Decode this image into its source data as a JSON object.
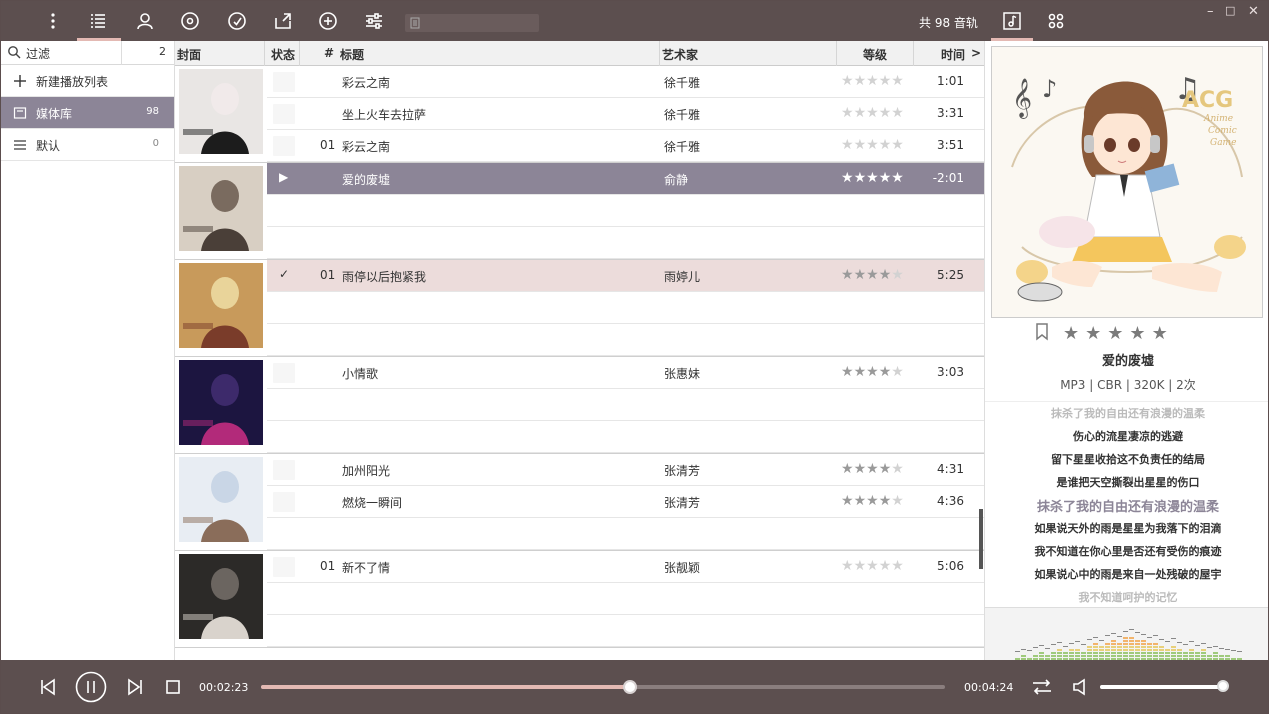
{
  "topbar": {
    "icons": [
      "more-vertical-icon",
      "list-icon",
      "user-icon",
      "disc-icon",
      "gauge-icon",
      "export-icon",
      "add-circle-icon",
      "equalizer-icon"
    ],
    "active_icon": "list-icon",
    "track_count": "共 98 音轨",
    "right_icons": [
      "music-note-icon",
      "grid-icon"
    ],
    "window_buttons": [
      "–",
      "□",
      "✕"
    ]
  },
  "sidebar": {
    "filter_label": "过滤",
    "filter_count": "2",
    "items": [
      {
        "icon": "plus-icon",
        "label": "新建播放列表",
        "count": ""
      },
      {
        "icon": "library-icon",
        "label": "媒体库",
        "count": "98",
        "active": true
      },
      {
        "icon": "list-icon",
        "label": "默认",
        "count": "0"
      }
    ]
  },
  "table": {
    "headers": {
      "cover": "封面",
      "status": "状态",
      "number": "#",
      "title": "标题",
      "artist": "艺术家",
      "rating": "等级",
      "time": "时间",
      "more": ">"
    },
    "groups": [
      {
        "cover": "cover-woman-dark",
        "rows": [
          {
            "num": "",
            "title": "彩云之南",
            "artist": "徐千雅",
            "rating": 0,
            "time": "1:01",
            "state": ""
          },
          {
            "num": "",
            "title": "坐上火车去拉萨",
            "artist": "徐千雅",
            "rating": 0,
            "time": "3:31",
            "state": ""
          },
          {
            "num": "01",
            "title": "彩云之南",
            "artist": "徐千雅",
            "rating": 0,
            "time": "3:51",
            "state": ""
          }
        ]
      },
      {
        "cover": "cover-calligraphy",
        "rows": [
          {
            "num": "",
            "title": "爱的废墟",
            "artist": "俞静",
            "rating": 5,
            "time": "-2:01",
            "state": "playing"
          },
          {
            "num": "",
            "title": "",
            "artist": "",
            "rating": -1,
            "time": "",
            "state": "empty"
          },
          {
            "num": "",
            "title": "",
            "artist": "",
            "rating": -1,
            "time": "",
            "state": "empty"
          }
        ]
      },
      {
        "cover": "cover-costume-drama",
        "rows": [
          {
            "num": "01",
            "title": "雨停以后抱紧我",
            "artist": "雨婷儿",
            "rating": 4,
            "time": "5:25",
            "state": "selected"
          },
          {
            "num": "",
            "title": "",
            "artist": "",
            "rating": -1,
            "time": "",
            "state": "empty"
          },
          {
            "num": "",
            "title": "",
            "artist": "",
            "rating": -1,
            "time": "",
            "state": "empty"
          }
        ]
      },
      {
        "cover": "cover-stage-singer",
        "rows": [
          {
            "num": "",
            "title": "小情歌",
            "artist": "张惠妹",
            "rating": 4,
            "time": "3:03",
            "state": ""
          },
          {
            "num": "",
            "title": "",
            "artist": "",
            "rating": -1,
            "time": "",
            "state": "empty"
          },
          {
            "num": "",
            "title": "",
            "artist": "",
            "rating": -1,
            "time": "",
            "state": "empty"
          }
        ]
      },
      {
        "cover": "cover-portrait-light",
        "rows": [
          {
            "num": "",
            "title": "加州阳光",
            "artist": "张清芳",
            "rating": 4,
            "time": "4:31",
            "state": ""
          },
          {
            "num": "",
            "title": "燃烧一瞬间",
            "artist": "张清芳",
            "rating": 4,
            "time": "4:36",
            "state": ""
          },
          {
            "num": "",
            "title": "",
            "artist": "",
            "rating": -1,
            "time": "",
            "state": "empty"
          }
        ]
      },
      {
        "cover": "cover-studio-mic",
        "rows": [
          {
            "num": "01",
            "title": "新不了情",
            "artist": "张靓颖",
            "rating": 0,
            "time": "5:06",
            "state": ""
          },
          {
            "num": "",
            "title": "",
            "artist": "",
            "rating": -1,
            "time": "",
            "state": "empty"
          },
          {
            "num": "",
            "title": "",
            "artist": "",
            "rating": -1,
            "time": "",
            "state": "empty"
          }
        ]
      }
    ]
  },
  "now_playing": {
    "art_text": {
      "acg": "ACG",
      "sub1": "Anime",
      "sub2": "Comic",
      "sub3": "Game"
    },
    "rating": 0,
    "title": "爱的废墟",
    "meta": "MP3 | CBR | 320K | 2次",
    "lyrics": [
      {
        "text": "抹杀了我的自由还有浪漫的温柔",
        "style": "faded"
      },
      {
        "text": "伤心的流星凄凉的逃避",
        "style": ""
      },
      {
        "text": "留下星星收拾这不负责任的结局",
        "style": ""
      },
      {
        "text": "是谁把天空撕裂出星星的伤口",
        "style": ""
      },
      {
        "text": "抹杀了我的自由还有浪漫的温柔",
        "style": "current"
      },
      {
        "text": "如果说天外的雨是星星为我落下的泪滴",
        "style": ""
      },
      {
        "text": "我不知道在你心里是否还有受伤的痕迹",
        "style": ""
      },
      {
        "text": "如果说心中的雨是来自一处残破的屋宇",
        "style": ""
      },
      {
        "text": "我不知道呵护的记忆",
        "style": "faded"
      }
    ]
  },
  "player": {
    "current_time": "00:02:23",
    "total_time": "00:04:24",
    "progress": 0.54,
    "volume": 0.98,
    "icons": [
      "prev-icon",
      "pause-icon",
      "next-icon",
      "stop-icon",
      "shuffle-icon",
      "volume-icon"
    ]
  },
  "colors": {
    "bar": "#5c4f4f",
    "accent": "#e3b9b3",
    "playing_row": "#8c8597",
    "selected_row": "#ecdcdb"
  }
}
